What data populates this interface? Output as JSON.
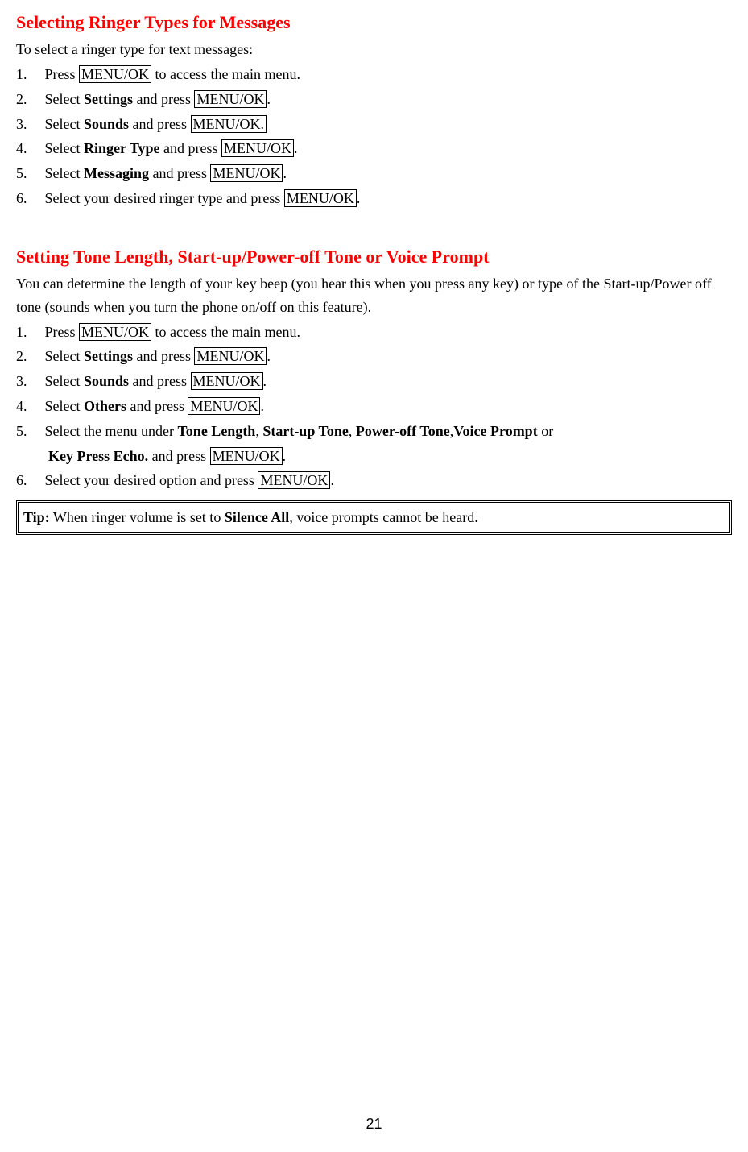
{
  "section1": {
    "heading": "Selecting Ringer Types for Messages",
    "intro": "To select a ringer type for text messages:",
    "steps": {
      "s1_a": "Press ",
      "s1_key": "MENU/OK",
      "s1_b": " to access the main menu.",
      "s2_a": "Select ",
      "s2_bold": "Settings",
      "s2_b": " and press ",
      "s2_key": "MENU/OK",
      "s2_c": ".",
      "s3_a": "Select ",
      "s3_bold": "Sounds",
      "s3_b": " and press ",
      "s3_key": "MENU/OK.",
      "s4_a": "Select ",
      "s4_bold": "Ringer Type",
      "s4_b": " and press ",
      "s4_key": "MENU/OK",
      "s4_c": ".",
      "s5_a": "Select ",
      "s5_bold": "Messaging",
      "s5_b": " and press ",
      "s5_key": "MENU/OK",
      "s5_c": ".",
      "s6_a": "Select your desired ringer type and press ",
      "s6_key": "MENU/OK",
      "s6_b": "."
    }
  },
  "section2": {
    "heading": "Setting Tone Length, Start-up/Power-off Tone or Voice Prompt",
    "intro": "You can determine the length of your key beep (you hear this when you press any key) or type of the Start-up/Power off tone (sounds when you turn the phone on/off on this feature).",
    "steps": {
      "s1_a": "Press ",
      "s1_key": "MENU/OK",
      "s1_b": " to access the main menu.",
      "s2_a": "Select ",
      "s2_bold": "Settings",
      "s2_b": " and press ",
      "s2_key": "MENU/OK",
      "s2_c": ".",
      "s3_a": "Select ",
      "s3_bold": "Sounds",
      "s3_b": " and press ",
      "s3_key": "MENU/OK",
      "s3_c": ".",
      "s4_a": "Select ",
      "s4_bold": "Others",
      "s4_b": " and press ",
      "s4_key": "MENU/OK",
      "s4_c": ".",
      "s5_a": "Select the menu under ",
      "s5_b1": "Tone Length",
      "s5_sep1": ", ",
      "s5_b2": "Start-up Tone",
      "s5_sep2": ", ",
      "s5_b3": "Power-off Tone",
      "s5_sep3": ",",
      "s5_b4": "Voice Prompt",
      "s5_or": "    or",
      "s5_cont_bold": "Key Press Echo.",
      "s5_cont_a": " and press ",
      "s5_cont_key": "MENU/OK",
      "s5_cont_b": ".",
      "s6_a": "Select your desired option and press ",
      "s6_key": "MENU/OK",
      "s6_b": "."
    }
  },
  "tip": {
    "label": "Tip:",
    "text_a": " When ringer volume is set to ",
    "bold": "Silence All",
    "text_b": ", voice prompts cannot be heard."
  },
  "nums": {
    "n1": "1.",
    "n2": "2.",
    "n3": "3.",
    "n4": "4.",
    "n5": "5.",
    "n6": "6."
  },
  "page_number": "21"
}
